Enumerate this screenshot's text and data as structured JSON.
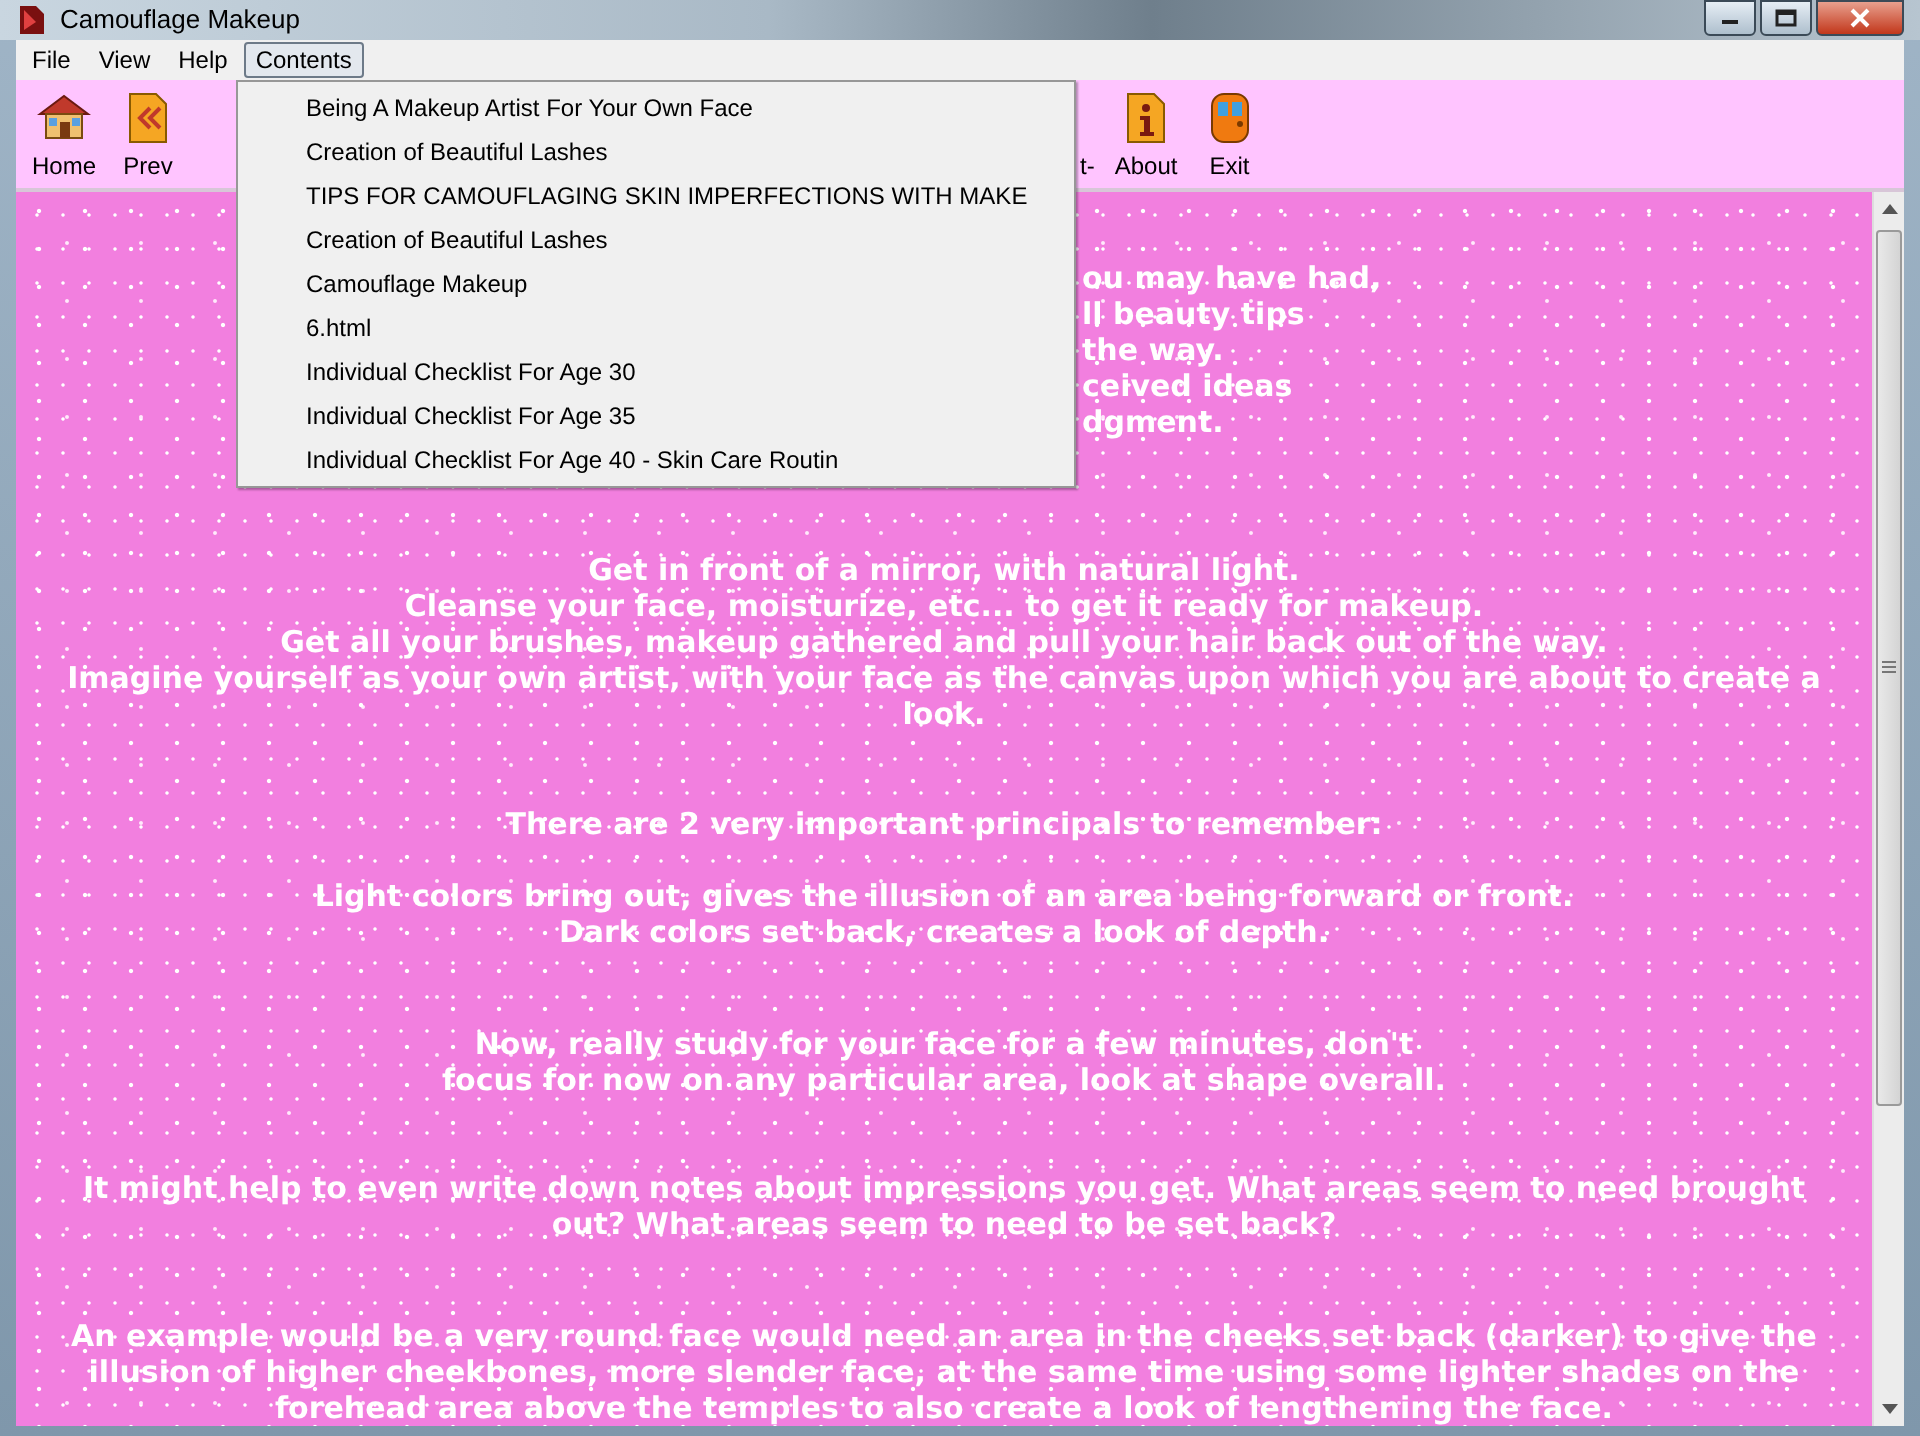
{
  "window": {
    "title": "Camouflage Makeup"
  },
  "menubar": [
    {
      "label": "File",
      "selected": false
    },
    {
      "label": "View",
      "selected": false
    },
    {
      "label": "Help",
      "selected": false
    },
    {
      "label": "Contents",
      "selected": true
    }
  ],
  "toolbar": [
    {
      "kind": "home",
      "label": "Home"
    },
    {
      "kind": "prev",
      "label": "Prev"
    },
    {
      "kind": "covered",
      "label": "t-"
    },
    {
      "kind": "about",
      "label": "About"
    },
    {
      "kind": "exit",
      "label": "Exit"
    }
  ],
  "contents_menu": [
    "Being A Makeup Artist For Your Own Face",
    "Creation of Beautiful Lashes",
    "TIPS FOR CAMOUFLAGING SKIN IMPERFECTIONS WITH MAKE",
    "Creation of Beautiful Lashes",
    "Camouflage Makeup",
    "6.html",
    "Individual Checklist For Age 30",
    "Individual Checklist For Age 35",
    "Individual Checklist For Age 40 - Skin Care Routin"
  ],
  "paragraphs": [
    {
      "kind": "covered",
      "lines": [
        "ou may have had,",
        "ll beauty tips",
        "the way.",
        "ceived ideas",
        "dgment."
      ]
    },
    {
      "kind": "full",
      "lines": [
        "Get in front of a mirror, with natural light.",
        "Cleanse your face, moisturize, etc... to get it ready for makeup.",
        "Get all your brushes, makeup gathered and pull your hair back out of the way.",
        "Imagine yourself as your own artist, with your face as the canvas upon which you are about to create a look."
      ]
    },
    {
      "kind": "full",
      "lines": [
        "There are 2 very important principals to remember:"
      ]
    },
    {
      "kind": "full",
      "lines": [
        "Light colors bring out, gives the illusion of an area being forward or front.",
        "Dark colors set back, creates a look of depth."
      ]
    },
    {
      "kind": "full",
      "lines": [
        "Now, really study for your face for a few minutes, don't",
        "focus for now on any particular area, look at shape overall."
      ]
    },
    {
      "kind": "full",
      "lines": [
        "It might help to even write down notes about impressions you get. What areas seem to need brought out? What areas seem to need to be set back?"
      ]
    },
    {
      "kind": "full",
      "lines": [
        "An example would be a very round face would need an area in the cheeks set back (darker) to give the illusion of higher cheekbones, more slender face, at the same time using some lighter shades on the forehead area above the temples to also create a look of lengthening the face."
      ]
    }
  ]
}
